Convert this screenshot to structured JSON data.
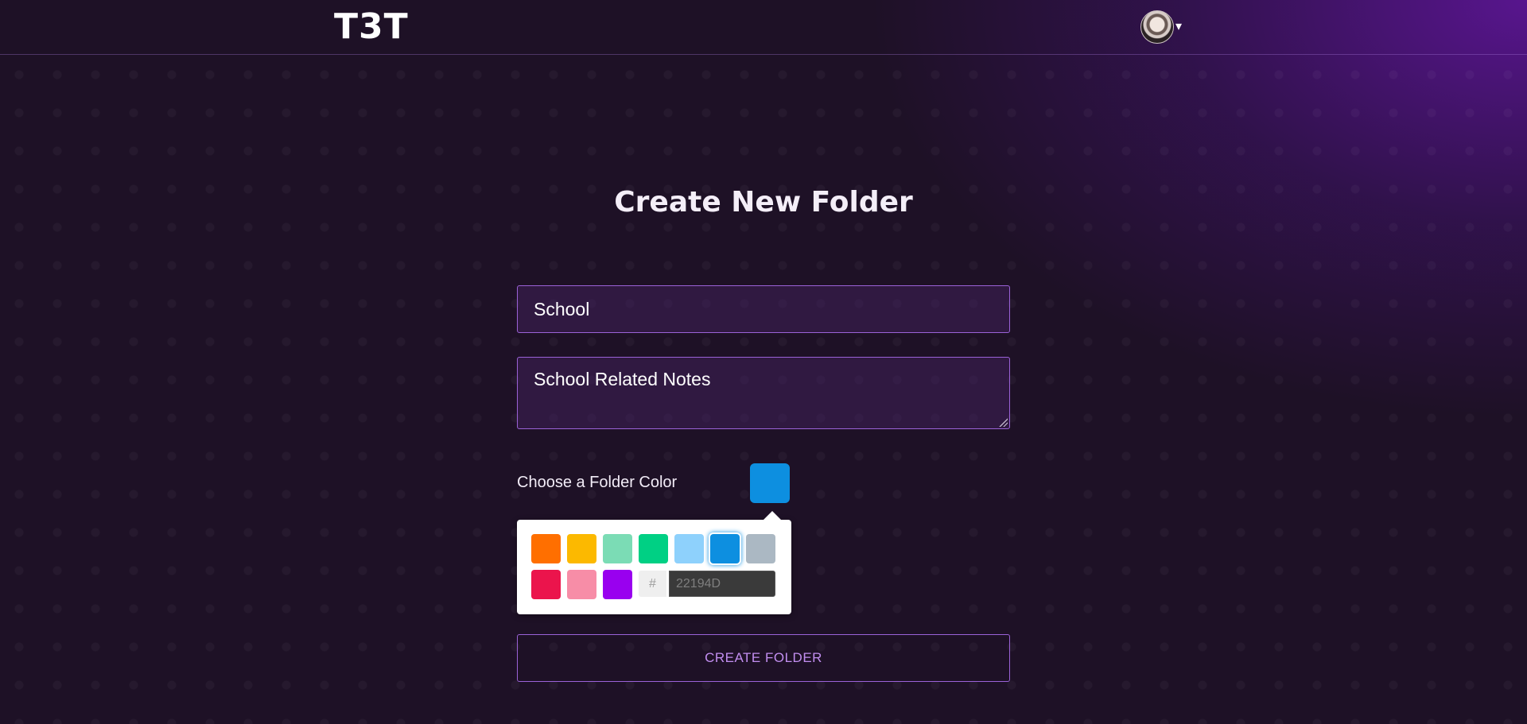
{
  "header": {
    "logo": "T3T",
    "avatar_icon": "user-avatar-icon",
    "menu_icon": "caret-down-icon",
    "caret": "▾"
  },
  "form": {
    "title": "Create New Folder",
    "name_value": "School",
    "description_value": "School Related Notes",
    "color_label": "Choose a Folder Color",
    "selected_color": "#0d8fe0",
    "swatches": [
      "#ff6f00",
      "#fcb900",
      "#7bdcb5",
      "#00d084",
      "#8ed1fc",
      "#0d8fe0",
      "#abb8c3",
      "#eb144c",
      "#f78da7",
      "#9900ef"
    ],
    "hash_label": "#",
    "hex_placeholder": "22194D",
    "submit_label": "CREATE FOLDER"
  },
  "theme": {
    "accent": "#9b62d8",
    "button_text": "#c28ef0"
  }
}
